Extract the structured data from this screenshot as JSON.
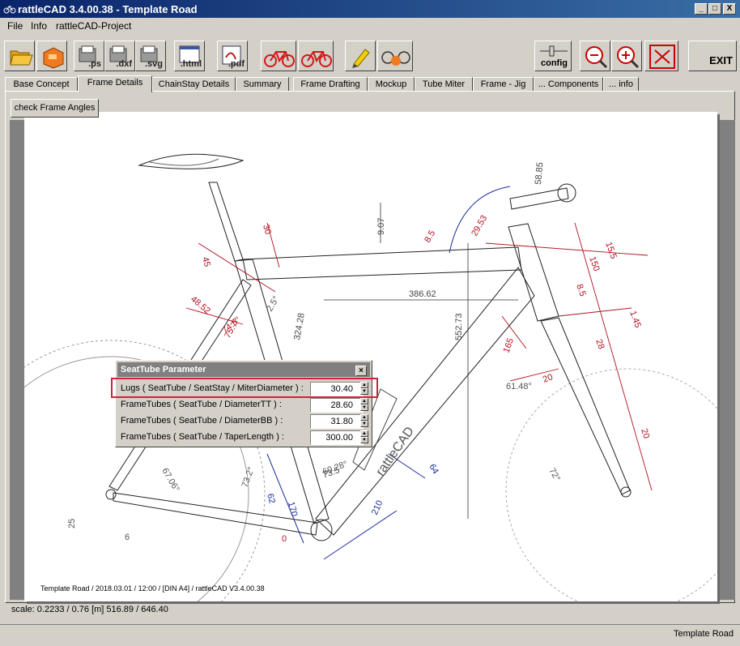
{
  "window": {
    "title": "rattleCAD  3.4.00.38 - Template Road",
    "controls": {
      "minimize": "_",
      "maximize": "□",
      "close": "X"
    }
  },
  "menu": [
    "File",
    "Info",
    "rattleCAD-Project"
  ],
  "toolbar": {
    "buttons": [
      {
        "name": "open-icon",
        "label": ""
      },
      {
        "name": "save-icon",
        "label": ""
      },
      {
        "name": "export-ps-icon",
        "label": ".ps"
      },
      {
        "name": "export-dxf-icon",
        "label": ".dxf"
      },
      {
        "name": "export-svg-icon",
        "label": ".svg"
      },
      {
        "name": "export-html-icon",
        "label": ".html"
      },
      {
        "name": "export-pdf-icon",
        "label": ".pdf"
      },
      {
        "name": "bike-red-icon",
        "label": ""
      },
      {
        "name": "bike-red-2-icon",
        "label": ""
      },
      {
        "name": "pen-icon",
        "label": ""
      },
      {
        "name": "bike-refresh-icon",
        "label": ""
      }
    ],
    "config_label": "config",
    "zoom_out": "zoom-out-icon",
    "zoom_in": "zoom-in-icon",
    "fit": "fit-icon",
    "exit_label": "EXIT"
  },
  "tabs": [
    "Base Concept",
    "Frame Details",
    "ChainStay Details",
    "Summary",
    "Frame Drafting",
    "Mockup",
    "Tube Miter",
    "Frame - Jig",
    "... Components",
    "... info"
  ],
  "active_tab": "Frame Details",
  "check_button": "check Frame Angles",
  "drawing": {
    "dimensions": [
      "386.62",
      "552.73",
      "324.28",
      "58.85",
      "15.5",
      "150",
      "73.5",
      "9.07",
      "1.45",
      "8.5",
      "28",
      "165",
      "20",
      "20",
      "30",
      "45",
      "48.52",
      "75.7°",
      "74.5°",
      "2.5°",
      "8.5",
      "29.53",
      "61.48°",
      "67.06°",
      "72°",
      "73.2°",
      "60.28°",
      "64",
      "210",
      "170",
      "62",
      "0",
      "25",
      "6"
    ],
    "brand_text": "rattleCAD",
    "footer": "Template Road   /   2018.03.01 / 12:00   /  [DIN A4]  /   rattleCAD   V3.4.00.38"
  },
  "dialog": {
    "title": "SeatTube Parameter",
    "close": "×",
    "rows": [
      {
        "label": "Lugs ( SeatTube / SeatStay / MiterDiameter ) :",
        "value": "30.40"
      },
      {
        "label": "FrameTubes ( SeatTube / DiameterTT ) :",
        "value": "28.60"
      },
      {
        "label": "FrameTubes ( SeatTube / DiameterBB ) :",
        "value": "31.80"
      },
      {
        "label": "FrameTubes ( SeatTube / TaperLength ) :",
        "value": "300.00"
      }
    ]
  },
  "status": {
    "scale": "scale: 0.2233 / 0.76  [m]  516.89 / 646.40",
    "project": "Template Road"
  },
  "colors": {
    "accent_red": "#d0223c",
    "dim_red": "#b01020",
    "dim_blue": "#1a2a9c",
    "title_blue": "#0a246a"
  }
}
